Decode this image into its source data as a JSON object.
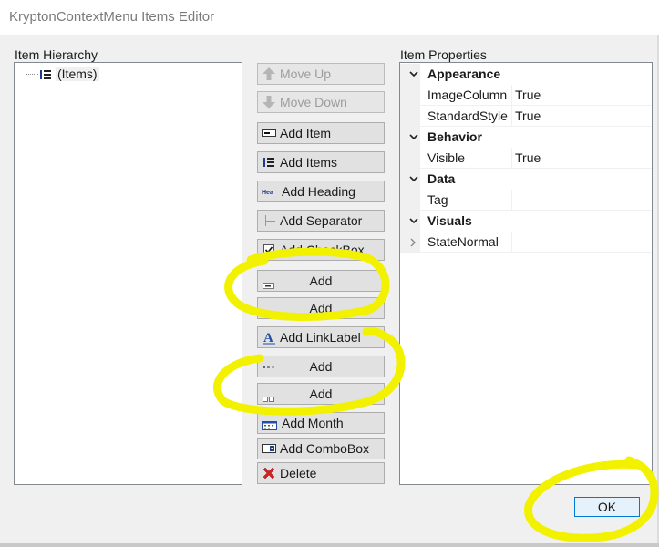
{
  "window": {
    "title": "KryptonContextMenu Items Editor"
  },
  "hierarchy": {
    "label": "Item Hierarchy",
    "root_item": "(Items)"
  },
  "buttons": {
    "move_up": "Move Up",
    "move_down": "Move Down",
    "add_item": "Add Item",
    "add_items": "Add Items",
    "add_heading": "Add Heading",
    "add_heading_icon_text": "Hea",
    "add_separator": "Add Separator",
    "add_checkbox": "Add CheckBox",
    "add_1": "Add",
    "add_2": "Add",
    "add_linklabel": "Add LinkLabel",
    "add_linklabel_icon_text": "A",
    "add_3": "Add",
    "add_4": "Add",
    "add_month": "Add Month",
    "add_combobox": "Add ComboBox",
    "delete": "Delete"
  },
  "properties": {
    "label": "Item Properties",
    "categories": [
      {
        "name": "Appearance",
        "items": [
          {
            "name": "ImageColumn",
            "value": "True"
          },
          {
            "name": "StandardStyle",
            "value": "True"
          }
        ]
      },
      {
        "name": "Behavior",
        "items": [
          {
            "name": "Visible",
            "value": "True"
          }
        ]
      },
      {
        "name": "Data",
        "items": [
          {
            "name": "Tag",
            "value": ""
          }
        ]
      },
      {
        "name": "Visuals",
        "items": [
          {
            "name": "StateNormal",
            "value": ""
          }
        ]
      }
    ]
  },
  "footer": {
    "ok": "OK"
  },
  "colors": {
    "highlight": "#f2f200",
    "accent": "#0078d7",
    "delete_red": "#d32020"
  }
}
